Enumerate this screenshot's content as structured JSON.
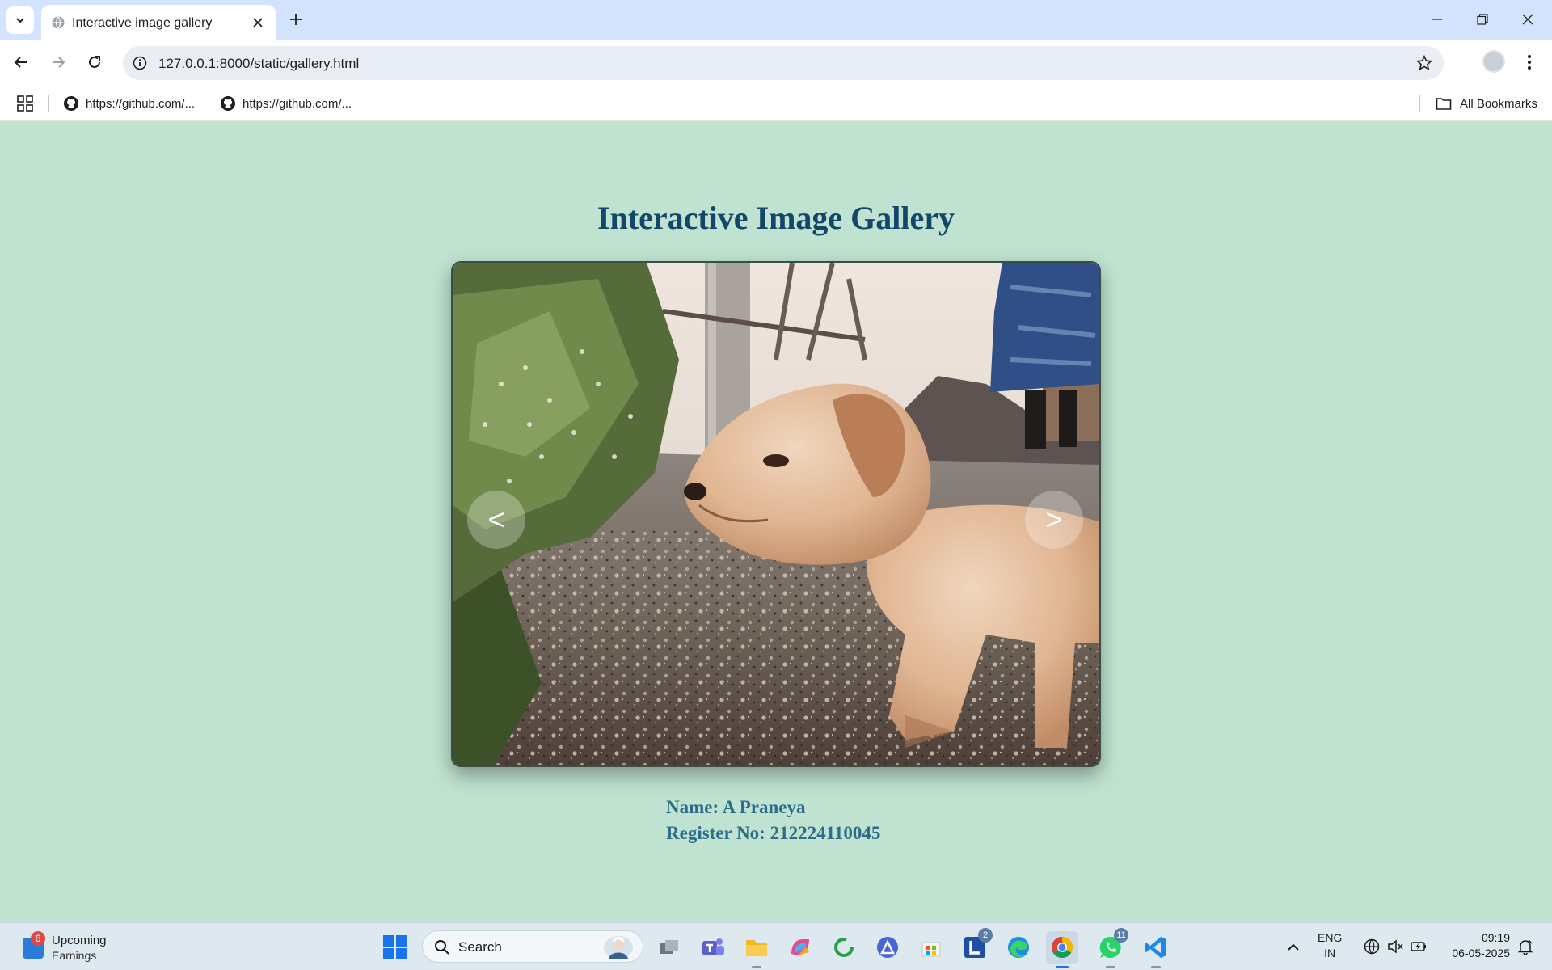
{
  "browser": {
    "tab_title": "Interactive image gallery",
    "url": "127.0.0.1:8000/static/gallery.html",
    "bookmarks": [
      {
        "label": "https://github.com/...",
        "icon": "github-icon"
      },
      {
        "label": "https://github.com/...",
        "icon": "github-icon"
      }
    ],
    "all_bookmarks_label": "All Bookmarks"
  },
  "page": {
    "title": "Interactive Image Gallery",
    "prev_label": "<",
    "next_label": ">",
    "name_line": "Name: A Praneya",
    "register_line": "Register No: 212224110045",
    "image_subject": "puppy on gravel ground"
  },
  "taskbar": {
    "widget_title": "Upcoming",
    "widget_subtitle": "Earnings",
    "widget_badge": "6",
    "search_label": "Search",
    "apps": [
      {
        "name": "task-view",
        "badge": ""
      },
      {
        "name": "teams",
        "badge": ""
      },
      {
        "name": "file-explorer",
        "badge": ""
      },
      {
        "name": "copilot",
        "badge": ""
      },
      {
        "name": "app-green-ring",
        "badge": ""
      },
      {
        "name": "app-blue-triangle",
        "badge": ""
      },
      {
        "name": "microsoft-store",
        "badge": ""
      },
      {
        "name": "app-l",
        "badge": "2"
      },
      {
        "name": "edge",
        "badge": ""
      },
      {
        "name": "chrome",
        "badge": ""
      },
      {
        "name": "whatsapp",
        "badge": "11"
      },
      {
        "name": "vscode",
        "badge": ""
      }
    ],
    "lang_line1": "ENG",
    "lang_line2": "IN",
    "time": "09:19",
    "date": "06-05-2025"
  },
  "colors": {
    "page_bg": "#bfe3d0",
    "title_color": "#12476a",
    "info_color": "#2b6d8a",
    "tabbar_bg": "#d3e3fd"
  }
}
